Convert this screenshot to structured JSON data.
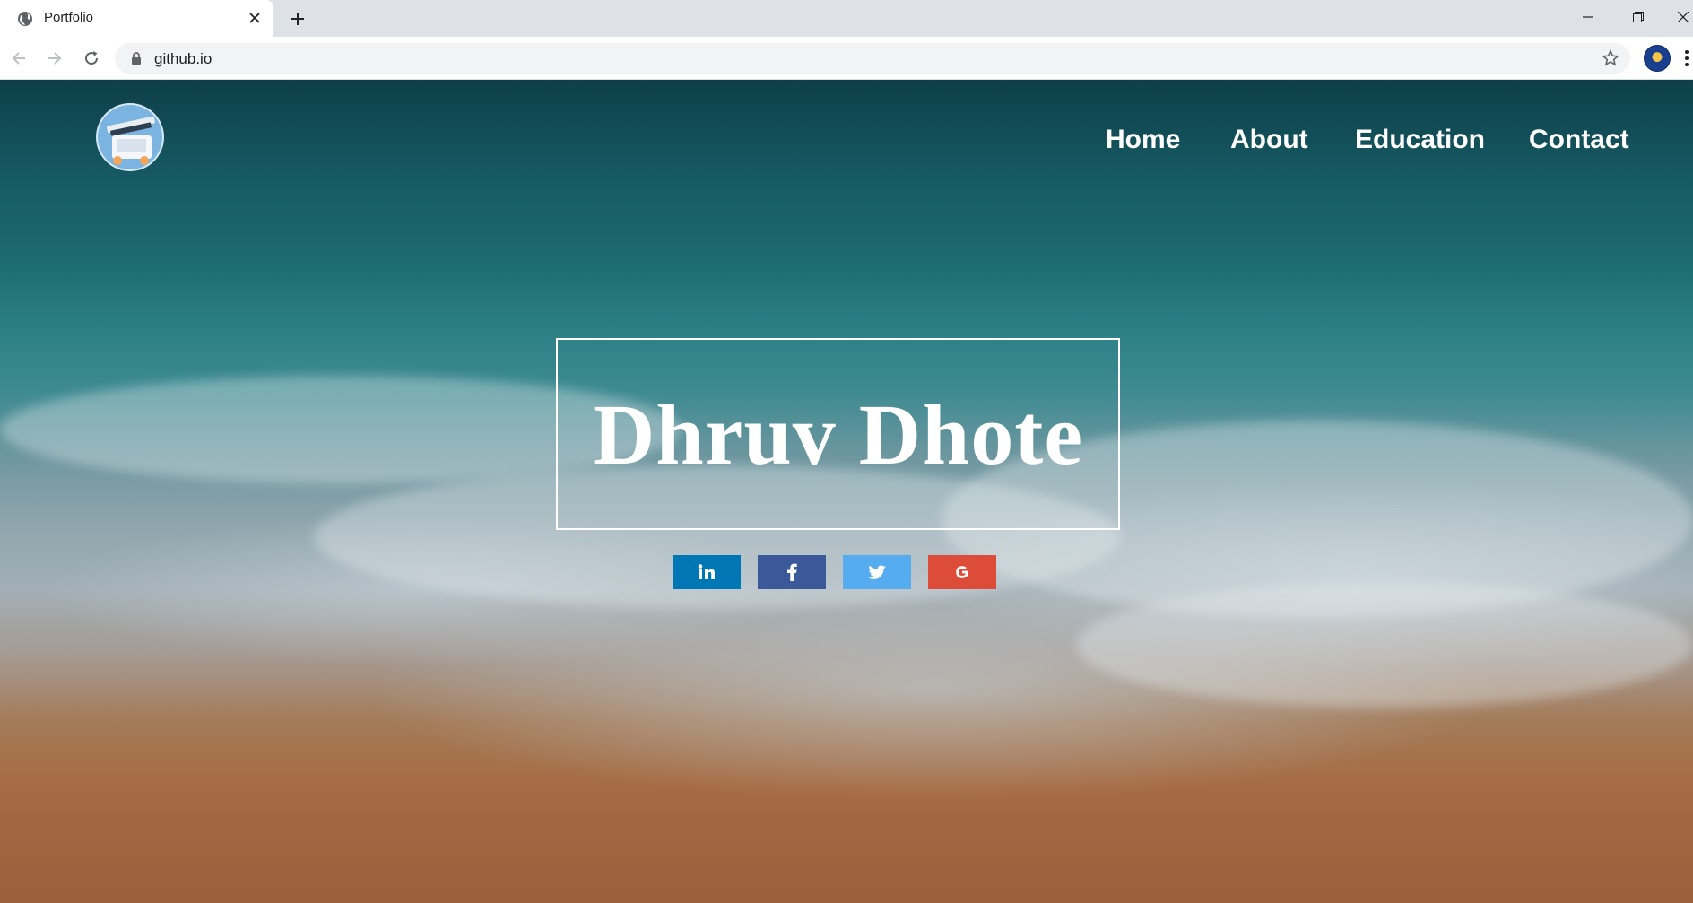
{
  "browser": {
    "tab_title": "Portfolio",
    "url": "github.io"
  },
  "page": {
    "nav": [
      {
        "label": "Home"
      },
      {
        "label": "About"
      },
      {
        "label": "Education"
      },
      {
        "label": "Contact"
      }
    ],
    "hero_title": "Dhruv Dhote",
    "social": [
      {
        "name": "linkedin",
        "icon": "linkedin-icon",
        "glyph": "in",
        "color": "#0077b5"
      },
      {
        "name": "facebook",
        "icon": "facebook-icon",
        "glyph": "f",
        "color": "#3b5998"
      },
      {
        "name": "twitter",
        "icon": "twitter-icon",
        "glyph": "",
        "color": "#55acee"
      },
      {
        "name": "google",
        "icon": "google-icon",
        "glyph": "G",
        "color": "#dd4b39"
      }
    ]
  },
  "colors": {
    "chrome_bg": "#dee1e6",
    "nav_text": "#ffffff",
    "ocean": "#165a64",
    "sand": "#a66b43"
  }
}
